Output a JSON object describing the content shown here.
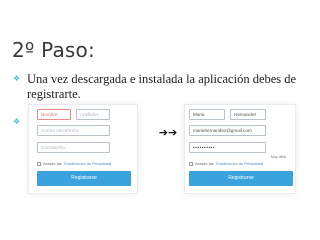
{
  "slide": {
    "title": "2º Paso:",
    "bullets": [
      {
        "marker": "❖",
        "text": "Una vez descargada e instalada la aplicación debes de registrarte."
      },
      {
        "marker": "❖",
        "text": ""
      }
    ],
    "accent_color": "#46c2c9"
  },
  "forms": {
    "empty": {
      "first_name_placeholder": "Nombre",
      "last_name_placeholder": "Apellidos",
      "email_placeholder": "Correo electrónico",
      "password_placeholder": "Contraseña",
      "terms_prefix": "Acepto las",
      "terms_link": "Condiciones de Privacidad",
      "register_label": "Registrarse"
    },
    "filled": {
      "first_name_value": "Maria",
      "last_name_value": "Hernandez",
      "email_value": "mariahernandez@gmail.com",
      "password_value": "••••••••••",
      "strength_label": "Muy débil",
      "terms_prefix": "Acepto las",
      "terms_link": "Condiciones de Privacidad",
      "register_label": "Registrarse"
    },
    "button_color": "#3aa3de"
  },
  "arrows": "➔➔"
}
